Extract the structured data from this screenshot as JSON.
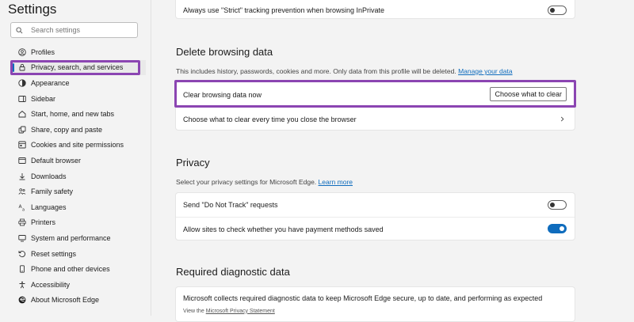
{
  "sidebar": {
    "title": "Settings",
    "search_placeholder": "Search settings",
    "items": [
      {
        "label": "Profiles",
        "icon": "profile-icon"
      },
      {
        "label": "Privacy, search, and services",
        "icon": "lock-icon",
        "active": true
      },
      {
        "label": "Appearance",
        "icon": "appearance-icon"
      },
      {
        "label": "Sidebar",
        "icon": "sidebar-icon"
      },
      {
        "label": "Start, home, and new tabs",
        "icon": "home-icon"
      },
      {
        "label": "Share, copy and paste",
        "icon": "share-icon"
      },
      {
        "label": "Cookies and site permissions",
        "icon": "cookies-icon"
      },
      {
        "label": "Default browser",
        "icon": "browser-icon"
      },
      {
        "label": "Downloads",
        "icon": "download-icon"
      },
      {
        "label": "Family safety",
        "icon": "family-icon"
      },
      {
        "label": "Languages",
        "icon": "languages-icon"
      },
      {
        "label": "Printers",
        "icon": "printer-icon"
      },
      {
        "label": "System and performance",
        "icon": "system-icon"
      },
      {
        "label": "Reset settings",
        "icon": "reset-icon"
      },
      {
        "label": "Phone and other devices",
        "icon": "phone-icon"
      },
      {
        "label": "Accessibility",
        "icon": "accessibility-icon"
      },
      {
        "label": "About Microsoft Edge",
        "icon": "edge-icon"
      }
    ]
  },
  "tracking": {
    "label": "Always use \"Strict\" tracking prevention when browsing InPrivate",
    "toggle_on": false
  },
  "delete_data": {
    "title": "Delete browsing data",
    "description": "This includes history, passwords, cookies and more. Only data from this profile will be deleted.",
    "manage_link": "Manage your data",
    "clear_now_label": "Clear browsing data now",
    "choose_button": "Choose what to clear",
    "clear_on_close_label": "Choose what to clear every time you close the browser"
  },
  "privacy": {
    "title": "Privacy",
    "description": "Select your privacy settings for Microsoft Edge.",
    "learn_more": "Learn more",
    "dnt_label": "Send \"Do Not Track\" requests",
    "dnt_on": false,
    "payment_label": "Allow sites to check whether you have payment methods saved",
    "payment_on": true
  },
  "diagnostic": {
    "title": "Required diagnostic data",
    "description": "Microsoft collects required diagnostic data to keep Microsoft Edge secure, up to date, and performing as expected",
    "view_prefix": "View the",
    "privacy_statement": "Microsoft Privacy Statement"
  },
  "colors": {
    "highlight": "#8b45b2",
    "accent": "#0f6cbd"
  }
}
